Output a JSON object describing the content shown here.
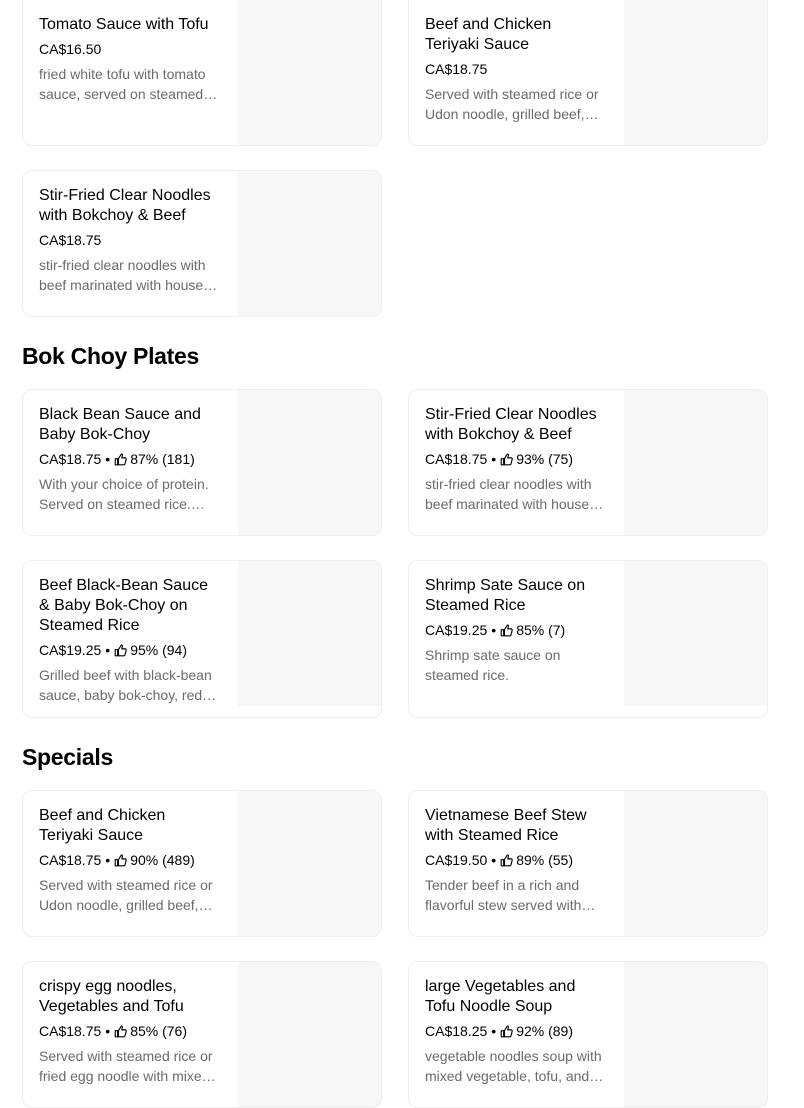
{
  "top_items": [
    {
      "title": "Tomato Sauce with Tofu",
      "price": "CA$16.50",
      "rating": "",
      "description": "fried white tofu with tomato sauce, served on steamed rice."
    },
    {
      "title": "Beef and Chicken Teriyaki Sauce",
      "price": "CA$18.75",
      "rating": "",
      "description": "Served with steamed rice or Udon noodle, grilled beef, chicken and teriyaki sauce."
    },
    {
      "title": "Stir-Fried Clear Noodles with Bokchoy & Beef",
      "price": "CA$18.75",
      "rating": "",
      "description": "stir-fried clear noodles with beef marinated with house sauce."
    }
  ],
  "sections": [
    {
      "title": "Bok Choy Plates",
      "items": [
        {
          "title": "Black Bean Sauce and Baby Bok-Choy",
          "price": "CA$18.75",
          "rating": "87% (181)",
          "description": "With your choice of protein. Served on steamed rice. Choose your protein."
        },
        {
          "title": "Stir-Fried Clear Noodles with Bokchoy & Beef",
          "price": "CA$18.75",
          "rating": "93% (75)",
          "description": "stir-fried clear noodles with beef marinated with house sauce."
        },
        {
          "title": "Beef Black-Bean Sauce & Baby Bok-Choy on Steamed Rice",
          "price": "CA$19.25",
          "rating": "95% (94)",
          "description": "Grilled beef with black-bean sauce, baby bok-choy, red pepper on steamed rice."
        },
        {
          "title": "Shrimp Sate Sauce on Steamed Rice",
          "price": "CA$19.25",
          "rating": "85% (7)",
          "description": "Shrimp sate sauce on steamed rice."
        }
      ]
    },
    {
      "title": "Specials",
      "items": [
        {
          "title": "Beef and Chicken Teriyaki Sauce",
          "price": "CA$18.75",
          "rating": "90% (489)",
          "description": "Served with steamed rice or Udon noodle, grilled beef, chicken and teriyaki sauce."
        },
        {
          "title": "Vietnamese Beef Stew with Steamed Rice",
          "price": "CA$19.50",
          "rating": "89% (55)",
          "description": "Tender beef in a rich and flavorful stew served with steamed rice."
        },
        {
          "title": "crispy egg noodles, Vegetables and Tofu",
          "price": "CA$18.75",
          "rating": "85% (76)",
          "description": "Served with steamed rice or fried egg noodle with mixed vegetables and tofu."
        },
        {
          "title": "large Vegetables and Tofu Noodle Soup",
          "price": "CA$18.25",
          "rating": "92% (89)",
          "description": "vegetable noodles soup with mixed vegetable, tofu, and noodles."
        }
      ]
    }
  ],
  "separator": "•",
  "icons": {
    "rating": "thumbs-up-icon"
  }
}
